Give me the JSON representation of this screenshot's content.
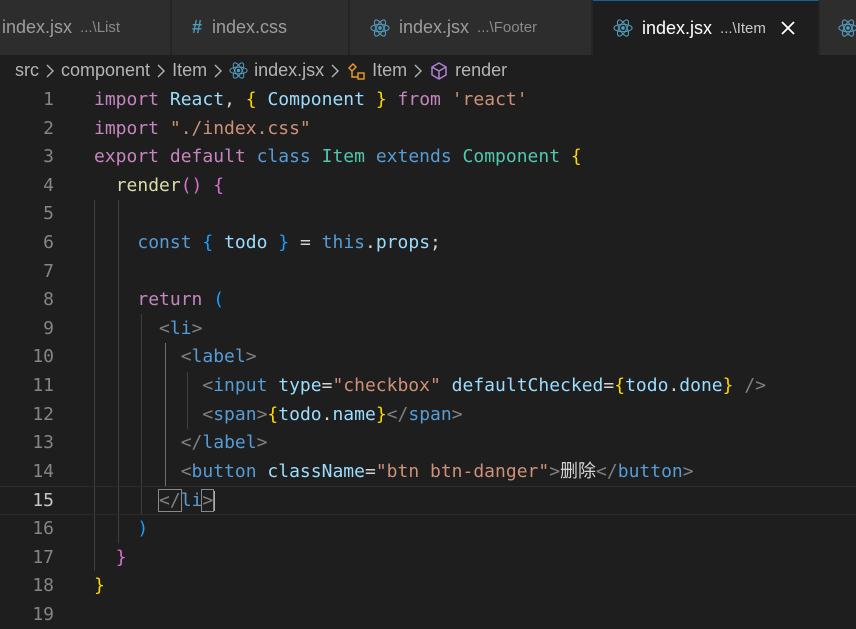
{
  "tabs": [
    {
      "name": "index.jsx",
      "path": "...\\List",
      "icon": "none",
      "active": false
    },
    {
      "name": "index.css",
      "path": "",
      "icon": "hash-icon",
      "active": false
    },
    {
      "name": "index.jsx",
      "path": "...\\Footer",
      "icon": "react-icon",
      "active": false
    },
    {
      "name": "index.jsx",
      "path": "...\\Item",
      "icon": "react-icon",
      "active": true
    }
  ],
  "breadcrumb": {
    "items": [
      "src",
      "component",
      "Item",
      "index.jsx",
      "Item",
      "render"
    ]
  },
  "editor": {
    "active_line": 15,
    "lines": [
      {
        "n": "1",
        "tokens": [
          [
            "kw",
            "import"
          ],
          [
            "pu",
            " "
          ],
          [
            "vr",
            "React"
          ],
          [
            "pu",
            ", "
          ],
          [
            "b1",
            "{"
          ],
          [
            "pu",
            " "
          ],
          [
            "vr",
            "Component"
          ],
          [
            "pu",
            " "
          ],
          [
            "b1",
            "}"
          ],
          [
            "pu",
            " "
          ],
          [
            "kw",
            "from"
          ],
          [
            "pu",
            " "
          ],
          [
            "str",
            "'react'"
          ]
        ]
      },
      {
        "n": "2",
        "tokens": [
          [
            "kw",
            "import"
          ],
          [
            "pu",
            " "
          ],
          [
            "str",
            "\"./index.css\""
          ]
        ]
      },
      {
        "n": "3",
        "tokens": [
          [
            "kw",
            "export"
          ],
          [
            "pu",
            " "
          ],
          [
            "kw",
            "default"
          ],
          [
            "pu",
            " "
          ],
          [
            "st",
            "class"
          ],
          [
            "pu",
            " "
          ],
          [
            "cl",
            "Item"
          ],
          [
            "pu",
            " "
          ],
          [
            "st",
            "extends"
          ],
          [
            "pu",
            " "
          ],
          [
            "cl",
            "Component"
          ],
          [
            "pu",
            " "
          ],
          [
            "b1",
            "{"
          ]
        ]
      },
      {
        "n": "4",
        "tokens": [
          [
            "pu",
            "  "
          ],
          [
            "fn",
            "render"
          ],
          [
            "b2",
            "()"
          ],
          [
            "pu",
            " "
          ],
          [
            "b2",
            "{"
          ]
        ]
      },
      {
        "n": "5",
        "tokens": []
      },
      {
        "n": "6",
        "tokens": [
          [
            "pu",
            "    "
          ],
          [
            "st",
            "const"
          ],
          [
            "pu",
            " "
          ],
          [
            "b3",
            "{"
          ],
          [
            "pu",
            " "
          ],
          [
            "vr",
            "todo"
          ],
          [
            "pu",
            " "
          ],
          [
            "b3",
            "}"
          ],
          [
            "pu",
            " = "
          ],
          [
            "st",
            "this"
          ],
          [
            "pu",
            "."
          ],
          [
            "vr",
            "props"
          ],
          [
            "pu",
            ";"
          ]
        ]
      },
      {
        "n": "7",
        "tokens": []
      },
      {
        "n": "8",
        "tokens": [
          [
            "pu",
            "    "
          ],
          [
            "kw",
            "return"
          ],
          [
            "pu",
            " "
          ],
          [
            "b3",
            "("
          ]
        ]
      },
      {
        "n": "9",
        "tokens": [
          [
            "pu",
            "      "
          ],
          [
            "tgp",
            "<"
          ],
          [
            "tag",
            "li"
          ],
          [
            "tgp",
            ">"
          ]
        ]
      },
      {
        "n": "10",
        "tokens": [
          [
            "pu",
            "        "
          ],
          [
            "tgp",
            "<"
          ],
          [
            "tag",
            "label"
          ],
          [
            "tgp",
            ">"
          ]
        ]
      },
      {
        "n": "11",
        "tokens": [
          [
            "pu",
            "          "
          ],
          [
            "tgp",
            "<"
          ],
          [
            "tag",
            "input"
          ],
          [
            "pu",
            " "
          ],
          [
            "at",
            "type"
          ],
          [
            "pu",
            "="
          ],
          [
            "str",
            "\"checkbox\""
          ],
          [
            "pu",
            " "
          ],
          [
            "at",
            "defaultChecked"
          ],
          [
            "pu",
            "="
          ],
          [
            "b1",
            "{"
          ],
          [
            "vr",
            "todo"
          ],
          [
            "pu",
            "."
          ],
          [
            "vr",
            "done"
          ],
          [
            "b1",
            "}"
          ],
          [
            "pu",
            " "
          ],
          [
            "tgp",
            "/>"
          ]
        ]
      },
      {
        "n": "12",
        "tokens": [
          [
            "pu",
            "          "
          ],
          [
            "tgp",
            "<"
          ],
          [
            "tag",
            "span"
          ],
          [
            "tgp",
            ">"
          ],
          [
            "b1",
            "{"
          ],
          [
            "vr",
            "todo"
          ],
          [
            "pu",
            "."
          ],
          [
            "vr",
            "name"
          ],
          [
            "b1",
            "}"
          ],
          [
            "tgp",
            "</"
          ],
          [
            "tag",
            "span"
          ],
          [
            "tgp",
            ">"
          ]
        ]
      },
      {
        "n": "13",
        "tokens": [
          [
            "pu",
            "        "
          ],
          [
            "tgp",
            "</"
          ],
          [
            "tag",
            "label"
          ],
          [
            "tgp",
            ">"
          ]
        ]
      },
      {
        "n": "14",
        "tokens": [
          [
            "pu",
            "        "
          ],
          [
            "tgp",
            "<"
          ],
          [
            "tag",
            "button"
          ],
          [
            "pu",
            " "
          ],
          [
            "at",
            "className"
          ],
          [
            "pu",
            "="
          ],
          [
            "str",
            "\"btn btn-danger\""
          ],
          [
            "tgp",
            ">"
          ],
          [
            "pu",
            "删除"
          ],
          [
            "tgp",
            "</"
          ],
          [
            "tag",
            "button"
          ],
          [
            "tgp",
            ">"
          ]
        ]
      },
      {
        "n": "15",
        "tokens": [
          [
            "pu",
            "      "
          ],
          [
            "tgp",
            "</"
          ],
          [
            "tag",
            "li"
          ],
          [
            "tgp",
            ">"
          ]
        ]
      },
      {
        "n": "16",
        "tokens": [
          [
            "pu",
            "    "
          ],
          [
            "b3",
            ")"
          ]
        ]
      },
      {
        "n": "17",
        "tokens": [
          [
            "pu",
            "  "
          ],
          [
            "b2",
            "}"
          ]
        ]
      },
      {
        "n": "18",
        "tokens": [
          [
            "b1",
            "}"
          ]
        ]
      },
      {
        "n": "19",
        "tokens": []
      }
    ]
  },
  "colors": {
    "accent": "#0e639c",
    "react": "#00b4e6",
    "method_icon": "#b180d7",
    "symbol_icon": "#ee9d28"
  }
}
